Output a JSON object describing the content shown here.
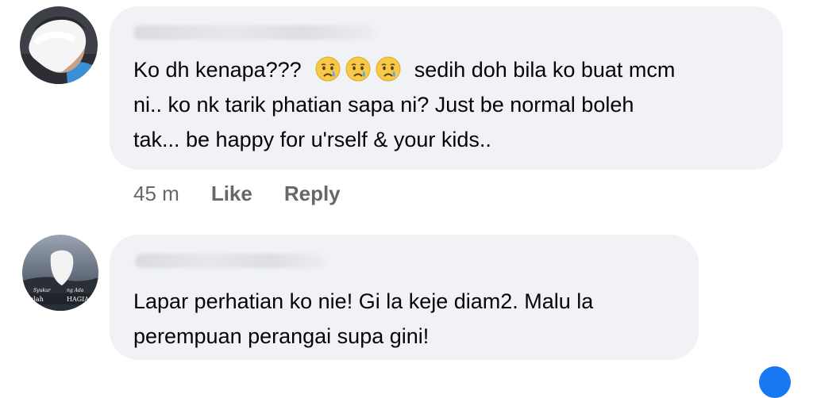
{
  "comments": [
    {
      "author": "",
      "line1_prefix": "Ko dh kenapa???",
      "line1_suffix": "sedih doh bila ko buat mcm",
      "line2": "ni..  ko nk tarik phatian sapa ni? Just be normal boleh",
      "line3": "tak... be happy for u'rself & your kids..",
      "emojis": [
        "crying-face",
        "crying-face",
        "crying-face"
      ],
      "time": "45 m",
      "like_label": "Like",
      "reply_label": "Reply"
    },
    {
      "author": "",
      "line1": "Lapar perhatian ko nie! Gi la keje diam2. Malu la",
      "line2": "perempuan perangai supa gini!",
      "avatar_caption_left": "Syukur",
      "avatar_caption_right": "ng Ada",
      "avatar_caption_bottom_left": "tulah",
      "avatar_caption_bottom_right": "HAGIA"
    }
  ],
  "colors": {
    "bubble": "#f0f2f5",
    "text": "#050505",
    "secondary": "#65676b",
    "accent": "#1877f2"
  }
}
